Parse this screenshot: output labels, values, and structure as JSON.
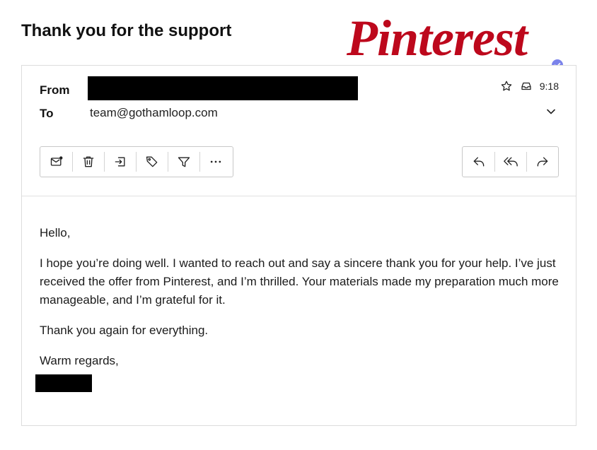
{
  "email": {
    "subject": "Thank you for the support",
    "logo_text": "Pinterest",
    "from_label": "From",
    "to_label": "To",
    "to_value": "team@gothamloop.com",
    "time": "9:18",
    "body": {
      "greeting": "Hello,",
      "paragraph1": "I hope you’re doing well. I wanted to reach out and say a sincere thank you for your help. I’ve just received the offer from Pinterest, and I’m thrilled. Your materials made my preparation much more manageable, and I’m grateful for it.",
      "paragraph2": "Thank you again for everything.",
      "closing": "Warm regards,"
    }
  },
  "toolbar_left": [
    "mark-unread-icon",
    "delete-icon",
    "move-icon",
    "tag-icon",
    "filter-icon",
    "more-icon"
  ],
  "toolbar_right": [
    "reply-icon",
    "reply-all-icon",
    "forward-icon"
  ],
  "colors": {
    "brand": "#bd081c",
    "verified": "#7b83eb"
  }
}
